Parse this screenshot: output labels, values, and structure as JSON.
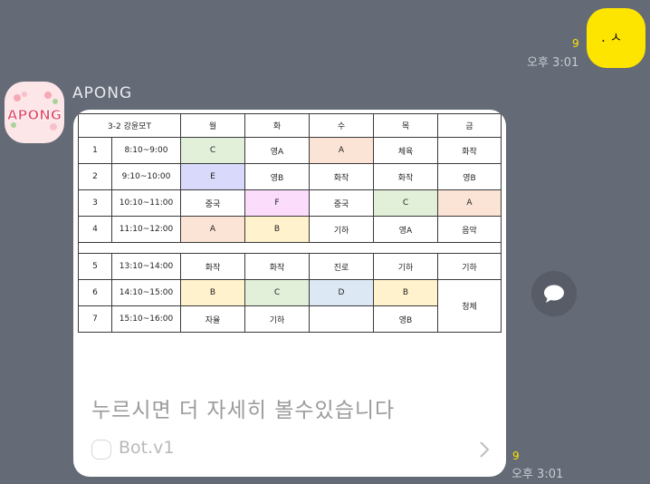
{
  "my_message": {
    "text": ". ㅅ",
    "unread": "9",
    "time": "오후 3:01"
  },
  "sender": {
    "name": "APONG",
    "avatar_text": "APONG"
  },
  "timetable": {
    "header": [
      "3-2  강윤모T",
      "월",
      "화",
      "수",
      "목",
      "금"
    ],
    "rows1": [
      {
        "period": "1",
        "time": "8:10~9:00",
        "cells": [
          "C",
          "영A",
          "A",
          "체육",
          "화작"
        ]
      },
      {
        "period": "2",
        "time": "9:10~10:00",
        "cells": [
          "E",
          "영B",
          "화작",
          "화작",
          "영B"
        ]
      },
      {
        "period": "3",
        "time": "10:10~11:00",
        "cells": [
          "중국",
          "F",
          "중국",
          "C",
          "A"
        ]
      },
      {
        "period": "4",
        "time": "11:10~12:00",
        "cells": [
          "A",
          "B",
          "기하",
          "영A",
          "음악"
        ]
      }
    ],
    "rows2": [
      {
        "period": "5",
        "time": "13:10~14:00",
        "cells": [
          "화작",
          "화작",
          "진로",
          "기하",
          "기하"
        ]
      },
      {
        "period": "6",
        "time": "14:10~15:00",
        "cells": [
          "B",
          "C",
          "D",
          "B",
          "청체"
        ]
      },
      {
        "period": "7",
        "time": "15:10~16:00",
        "cells": [
          "자율",
          "기하",
          "",
          "영B"
        ]
      }
    ]
  },
  "card": {
    "description": "누르시면 더 자세히 볼수있습니다",
    "bot_name": "Bot.v1"
  },
  "their_message": {
    "unread": "9",
    "time": "오후 3:01"
  },
  "colors": {
    "background": "#646a76",
    "my_bubble": "#fee500",
    "unread": "#fee500",
    "green": "#e2efd9",
    "purple": "#d9d9fc",
    "orange": "#fbe4d5",
    "pink": "#fbdcfb",
    "yellow": "#fff2cc",
    "blue": "#dce9f5"
  },
  "icons": {
    "share": "speech-bubble-icon",
    "chevron": "chevron-right-icon",
    "bot": "bot-icon"
  }
}
